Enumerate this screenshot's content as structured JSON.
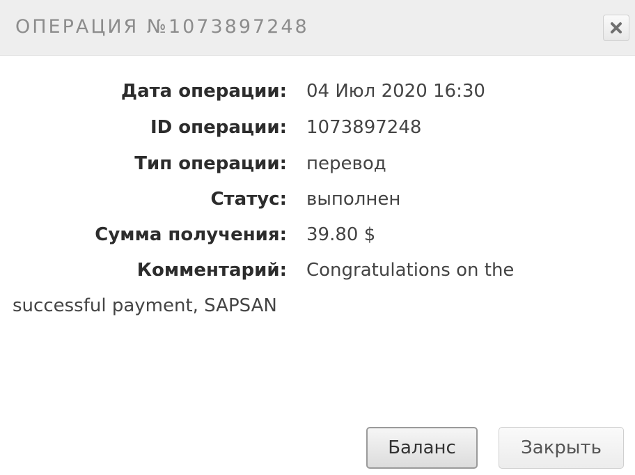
{
  "dialog": {
    "title": "ОПЕРАЦИЯ №1073897248",
    "close_icon": "close-x-icon"
  },
  "details": [
    {
      "label": "Дата операции:",
      "value": "04 Июл 2020 16:30"
    },
    {
      "label": "ID операции:",
      "value": "1073897248"
    },
    {
      "label": "Тип операции:",
      "value": "перевод"
    },
    {
      "label": "Статус:",
      "value": "выполнен"
    },
    {
      "label": "Сумма получения:",
      "value": "39.80 $"
    },
    {
      "label": "Комментарий:",
      "value": "Congratulations on the"
    }
  ],
  "comment_continuation": "successful payment, SAPSAN",
  "buttons": {
    "balance_label": "Баланс",
    "close_label": "Закрыть"
  }
}
